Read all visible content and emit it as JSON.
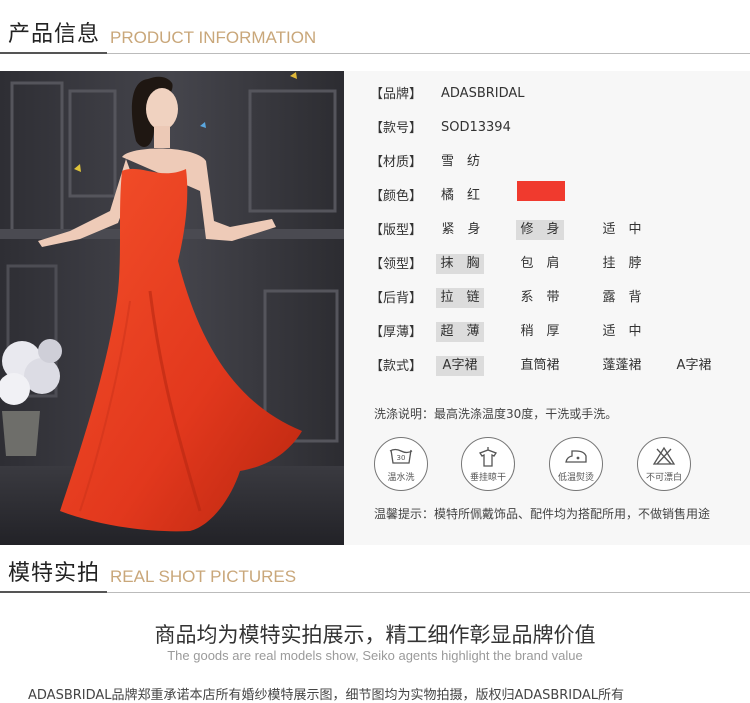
{
  "section1": {
    "title_zh": "产品信息",
    "title_en": "PRODUCT INFORMATION"
  },
  "rows": [
    {
      "label": "【品牌】",
      "value": "ADASBRIDAL"
    },
    {
      "label": "【款号】",
      "value": "SOD13394"
    },
    {
      "label": "【材质】",
      "value": "雪　纺"
    },
    {
      "label": "【颜色】",
      "value": "橘　红",
      "swatch_color": "#f03a2e"
    }
  ],
  "option_rows": [
    {
      "label": "【版型】",
      "options": [
        {
          "text": "紧　身",
          "selected": false
        },
        {
          "text": "修　身",
          "selected": true
        },
        {
          "text": "适　中",
          "selected": false
        }
      ]
    },
    {
      "label": "【领型】",
      "options": [
        {
          "text": "抹　胸",
          "selected": true
        },
        {
          "text": "包　肩",
          "selected": false
        },
        {
          "text": "挂　脖",
          "selected": false
        }
      ]
    },
    {
      "label": "【后背】",
      "options": [
        {
          "text": "拉　链",
          "selected": true
        },
        {
          "text": "系　带",
          "selected": false
        },
        {
          "text": "露　背",
          "selected": false
        }
      ]
    },
    {
      "label": "【厚薄】",
      "options": [
        {
          "text": "超　薄",
          "selected": true
        },
        {
          "text": "稍　厚",
          "selected": false
        },
        {
          "text": "适　中",
          "selected": false
        }
      ]
    },
    {
      "label": "【款式】",
      "options": [
        {
          "text": "A字裙",
          "selected": true
        },
        {
          "text": "直筒裙",
          "selected": false
        },
        {
          "text": "蓬蓬裙",
          "selected": false
        },
        {
          "text": "A字裙",
          "selected": false
        }
      ]
    }
  ],
  "wash_note": "洗涤说明：最高洗涤温度30度，干洗或手洗。",
  "care_icons": [
    {
      "icon": "wash-30-icon",
      "label": "温水洗",
      "mark": "30"
    },
    {
      "icon": "hang-dry-icon",
      "label": "垂挂晾干"
    },
    {
      "icon": "low-iron-icon",
      "label": "低温熨烫"
    },
    {
      "icon": "no-bleach-icon",
      "label": "不可漂白"
    }
  ],
  "tip": "温馨提示：模特所佩戴饰品、配件均为搭配所用，不做销售用途",
  "section2": {
    "title_zh": "模特实拍",
    "title_en": "REAL SHOT PICTURES"
  },
  "slogan_zh": "商品均为模特实拍展示，精工细作彰显品牌价值",
  "slogan_en": "The goods are real models show, Seiko agents highlight the brand value",
  "bottom_text": "ADASBRIDAL品牌郑重承诺本店所有婚纱模特展示图，细节图均为实物拍摄，版权归ADASBRIDAL所有",
  "colors": {
    "accent_gold": "#c9a77a",
    "dress_red": "#f03a2e",
    "selected_bg": "#dcdcdc"
  }
}
